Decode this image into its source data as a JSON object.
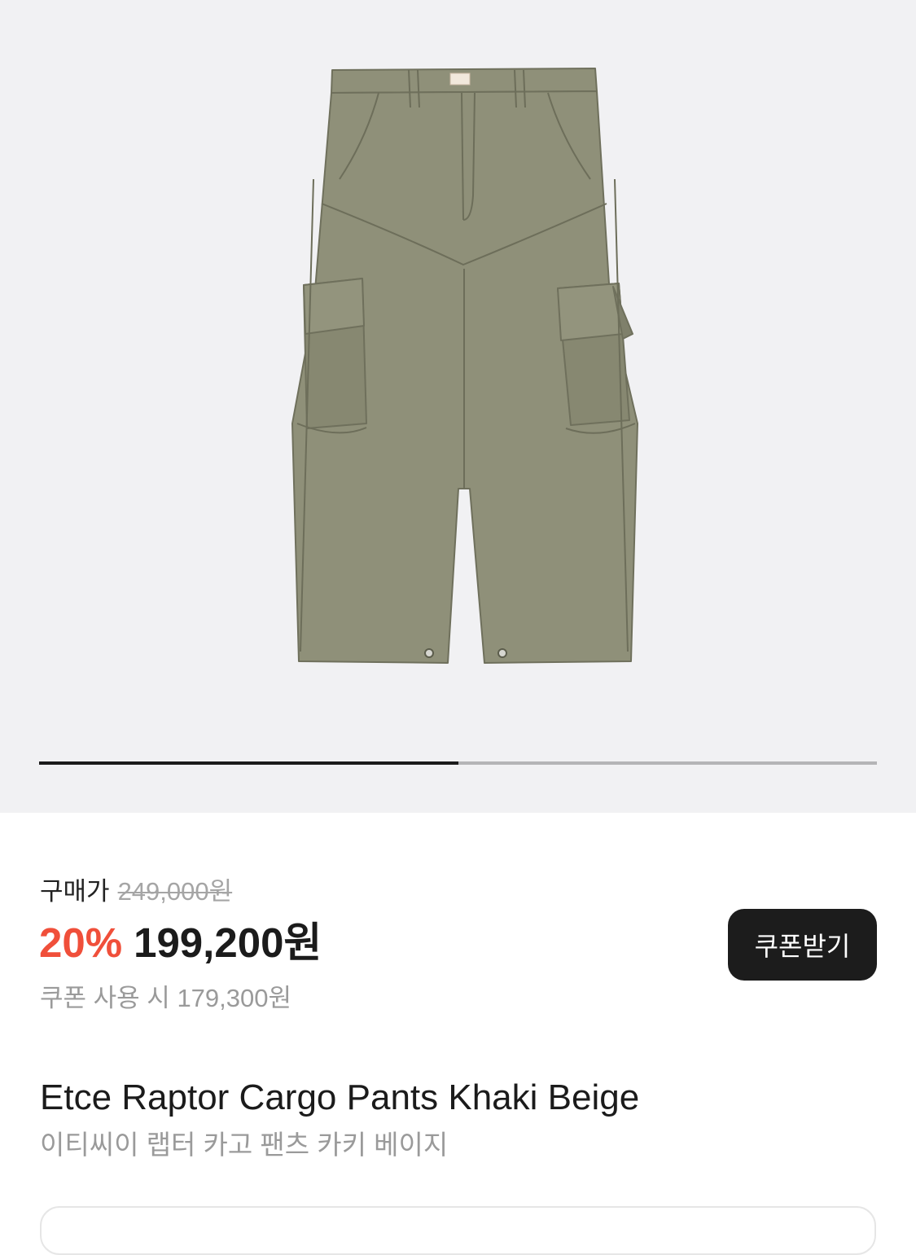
{
  "product": {
    "image_alt": "Etce Raptor Cargo Pants Khaki Beige",
    "image_color": "#8f9079",
    "gallery_progress": 0.5,
    "price_label": "구매가",
    "original_price": "249,000원",
    "discount_rate": "20%",
    "sale_price": "199,200원",
    "coupon_price_text": "쿠폰 사용 시 179,300원",
    "coupon_button_label": "쿠폰받기",
    "name_en": "Etce Raptor Cargo Pants Khaki Beige",
    "name_ko": "이티씨이 랩터 카고 팬츠 카키 베이지"
  },
  "colors": {
    "discount": "#f04f3a",
    "button_bg": "#1c1c1c",
    "muted_text": "#9a9a9a"
  }
}
